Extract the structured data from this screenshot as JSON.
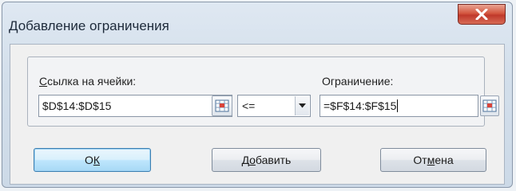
{
  "dialog": {
    "title": "Добавление ограничения",
    "close_label": "X"
  },
  "form": {
    "cell_ref_label_accel": "С",
    "cell_ref_label_rest": "сылка на ячейки:",
    "cell_ref_value": "$D$14:$D$15",
    "operator_value": "<=",
    "constraint_label": "Ограничение:",
    "constraint_value": "=$F$14:$F$15"
  },
  "buttons": {
    "ok_pre": "О",
    "ok_accel": "К",
    "add_pre": "Д",
    "add_accel": "о",
    "add_post": "бавить",
    "cancel_pre": "От",
    "cancel_accel": "м",
    "cancel_post": "ена"
  },
  "colors": {
    "close_button": "#c0392b",
    "default_button_border": "#3c7fb1"
  },
  "icons": [
    "close-icon",
    "range-select-icon",
    "chevron-down-icon"
  ]
}
